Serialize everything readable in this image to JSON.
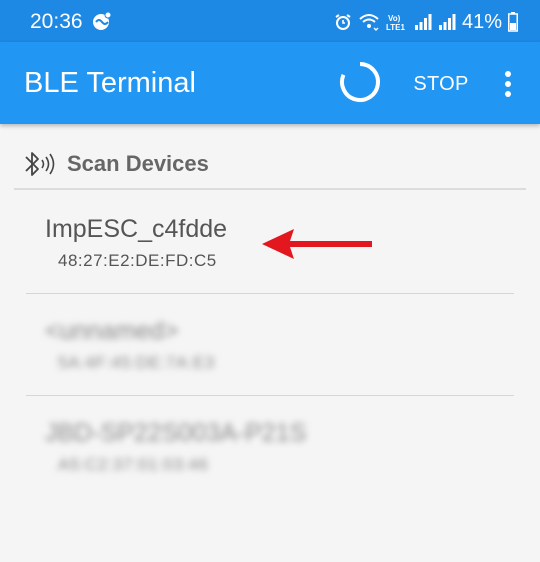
{
  "status_bar": {
    "time": "20:36",
    "battery": "41%",
    "icons": [
      "notification-icon",
      "alarm-icon",
      "wifi-icon",
      "volte-icon",
      "signal-icon",
      "signal-icon",
      "battery-icon"
    ],
    "network_badge": "Vo)\nLTE1"
  },
  "app_bar": {
    "title": "BLE Terminal",
    "stop_label": "STOP",
    "background": "#2196f3",
    "status_background": "#1e88e5"
  },
  "section": {
    "title": "Scan Devices",
    "icon": "bluetooth-scan-icon"
  },
  "devices": [
    {
      "name": "ImpESC_c4fdde",
      "address": "48:27:E2:DE:FD:C5",
      "blurred": false
    },
    {
      "name": "<unnamed>",
      "address": "5A:4F:45:DE:7A:E3",
      "blurred": true
    },
    {
      "name": "JBD-SP22S003A-P21S",
      "address": "A5:C2:37:01:03:46",
      "blurred": true
    }
  ],
  "annotation": {
    "type": "arrow",
    "color": "#e3171e",
    "points_to": "devices.0"
  }
}
